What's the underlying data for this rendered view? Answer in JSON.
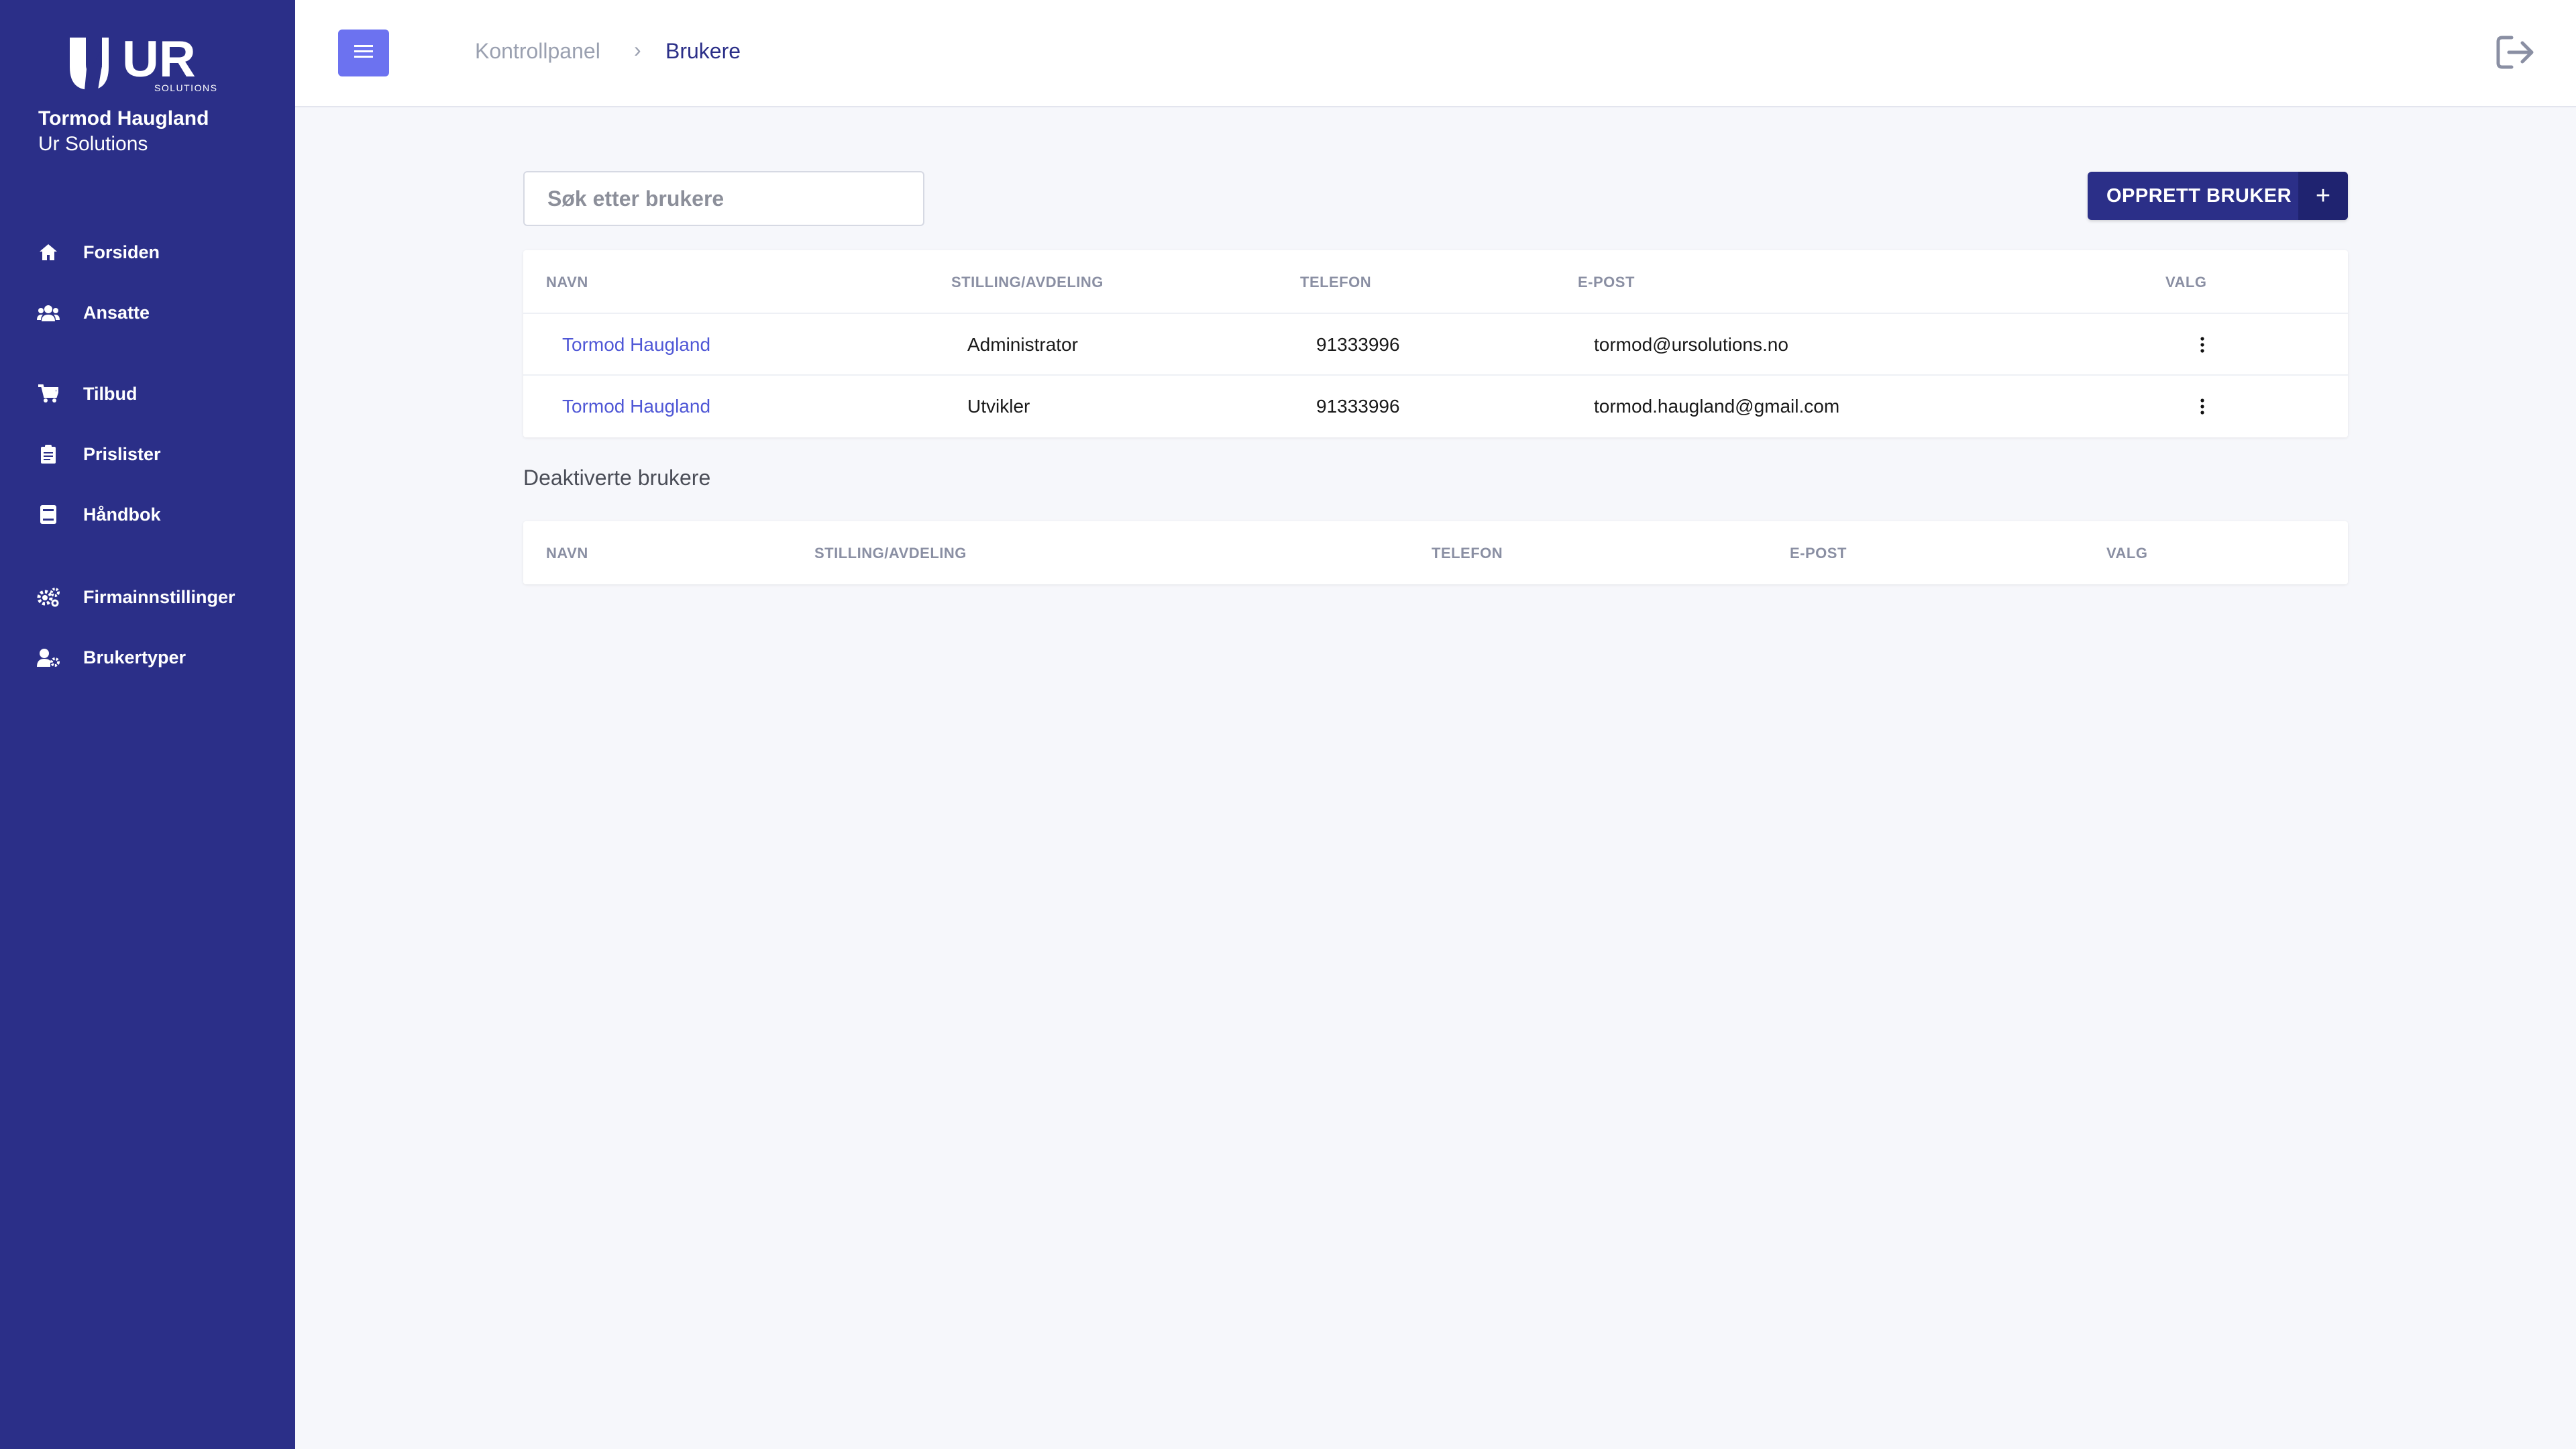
{
  "sidebar": {
    "logo_text": "UR",
    "logo_sub": "SOLUTIONS",
    "user_name": "Tormod Haugland",
    "company": "Ur Solutions",
    "items": [
      {
        "label": "Forsiden",
        "icon": "home-icon"
      },
      {
        "label": "Ansatte",
        "icon": "users-icon"
      },
      {
        "label": "Tilbud",
        "icon": "cart-icon"
      },
      {
        "label": "Prislister",
        "icon": "clipboard-icon"
      },
      {
        "label": "Håndbok",
        "icon": "book-icon"
      },
      {
        "label": "Firmainnstillinger",
        "icon": "gears-icon"
      },
      {
        "label": "Brukertyper",
        "icon": "user-cog-icon"
      }
    ]
  },
  "breadcrumb": {
    "parent": "Kontrollpanel",
    "separator": "›",
    "current": "Brukere"
  },
  "search": {
    "placeholder": "Søk etter brukere"
  },
  "create_button": {
    "label": "OPPRETT BRUKER",
    "icon": "+"
  },
  "active_table": {
    "headers": [
      "NAVN",
      "STILLING/AVDELING",
      "TELEFON",
      "E-POST",
      "VALG"
    ],
    "rows": [
      {
        "name": "Tormod Haugland",
        "role": "Administrator",
        "phone": "91333996",
        "email": "tormod@ursolutions.no"
      },
      {
        "name": "Tormod Haugland",
        "role": "Utvikler",
        "phone": "91333996",
        "email": "tormod.haugland@gmail.com"
      }
    ]
  },
  "deactivated": {
    "title": "Deaktiverte brukere",
    "headers": [
      "NAVN",
      "STILLING/AVDELING",
      "TELEFON",
      "E-POST",
      "VALG"
    ]
  },
  "colors": {
    "sidebar": "#2b2f88",
    "accent": "#6c72f0",
    "link": "#4f57d6"
  }
}
